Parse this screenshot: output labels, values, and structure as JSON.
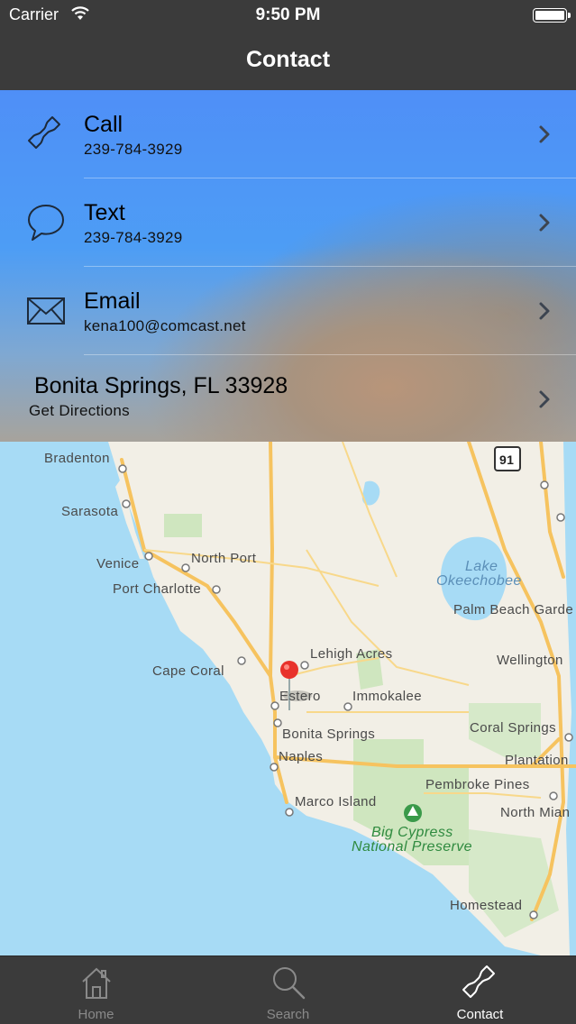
{
  "status_bar": {
    "carrier": "Carrier",
    "time": "9:50 PM"
  },
  "nav": {
    "title": "Contact"
  },
  "contact": {
    "call": {
      "label": "Call",
      "value": "239-784-3929",
      "icon": "phone-icon"
    },
    "text": {
      "label": "Text",
      "value": "239-784-3929",
      "icon": "chat-bubble-icon"
    },
    "email": {
      "label": "Email",
      "value": "kena100@comcast.net",
      "icon": "envelope-icon"
    },
    "location": {
      "label": "Bonita Springs, FL 33928",
      "value": "Get Directions"
    }
  },
  "map": {
    "places": [
      "Bradenton",
      "Sarasota",
      "Venice",
      "North Port",
      "Port Charlotte",
      "Cape Coral",
      "Lehigh Acres",
      "Estero",
      "Immokalee",
      "Bonita Springs",
      "Naples",
      "Marco Island",
      "Palm Beach Garde",
      "Wellington",
      "Coral Springs",
      "Plantation",
      "Pembroke Pines",
      "North Mian",
      "Homestead"
    ],
    "water_labels": [
      "Lake",
      "Okeechobee"
    ],
    "park_labels": [
      "Big Cypress",
      "National Preserve"
    ],
    "highway_shield": "91"
  },
  "tabs": [
    {
      "label": "Home",
      "icon": "home-icon",
      "active": false
    },
    {
      "label": "Search",
      "icon": "search-icon",
      "active": false
    },
    {
      "label": "Contact",
      "icon": "phone-icon",
      "active": true
    }
  ],
  "colors": {
    "bar": "#3b3b3b",
    "accent_blue": "#4d9df5",
    "pin_red": "#e8322b"
  }
}
